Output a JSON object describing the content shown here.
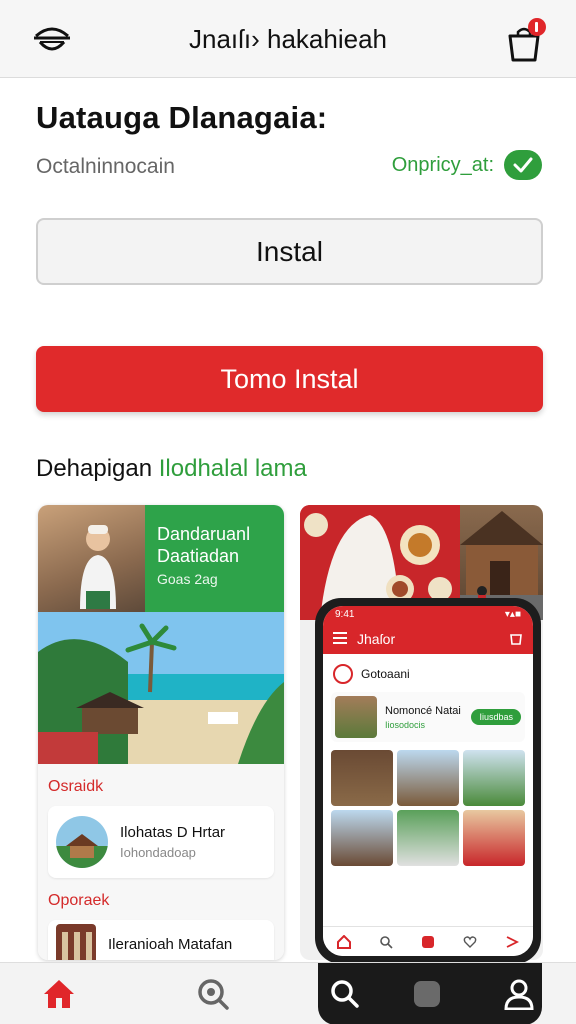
{
  "header": {
    "title": "Jnaıſı› hakahieah",
    "menu_icon": "store-hat-icon",
    "cart_icon": "bag-icon",
    "cart_badge": "!"
  },
  "app": {
    "name": "Uatauga Dlanagaia:",
    "developer": "Octalninnocain",
    "verified_label": "Onpricy_at:",
    "verified_icon": "check-icon"
  },
  "buttons": {
    "install": "Instal",
    "primary": "Tomo Instal"
  },
  "section": {
    "title_part1": "Dehapigan ",
    "title_part2": "Ilodhalal lama"
  },
  "screenshot_left": {
    "banner_title": "Dandaruanl Daatiadan",
    "banner_sub": "Goas 2ag",
    "section_1": "Osraidk",
    "item_1_title": "Ilohatas D Hrtar",
    "item_1_sub": "Iohondadoap",
    "section_2": "Oporaek",
    "item_2_title": "Ileranioah Matafan"
  },
  "screenshot_right": {
    "phone_status_time": "9:41",
    "phone_status_icons": "▾▴■",
    "phone_title": "Jhaſor",
    "phone_row_label": "Gotoaani",
    "phone_item_title": "Nomoncé Natai",
    "phone_item_sub": "Iiosodocis",
    "phone_item_pill": "Iiusdbas"
  },
  "bottom_nav": {
    "items": [
      "home-icon",
      "search-icon",
      "search-icon",
      "apps-icon",
      "profile-icon"
    ]
  },
  "colors": {
    "brand_red": "#e02a2b",
    "green": "#2f9e3c"
  }
}
